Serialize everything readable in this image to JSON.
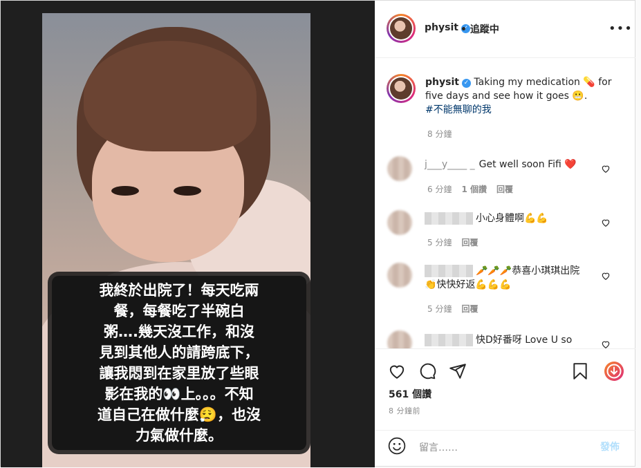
{
  "story": {
    "lines": [
      "我終於出院了！每天吃兩",
      "餐，每餐吃了半碗白",
      "粥….幾天沒工作，和沒",
      "見到其他人的請跨底下，",
      "讓我悶到在家里放了些眼",
      "影在我的👀上。。。不知",
      "道自己在做什麼😮‍💨，也沒",
      "力氣做什麼。"
    ]
  },
  "header": {
    "username": "physit",
    "verified_mark": "✓",
    "follow_status": "• 追蹤中",
    "more_icon": "•••"
  },
  "caption": {
    "username": "physit",
    "text": " Taking my medication 💊 for five days and see how it goes 😬.",
    "hashtag": "#不能無聊的我",
    "time": "8 分鐘"
  },
  "comments": [
    {
      "name_partial": "j___y____ _",
      "text": "Get well soon Fifi ❤️",
      "time": "6 分鐘",
      "likes": "1 個讚",
      "reply": "回覆"
    },
    {
      "name_partial": "",
      "text": "小心身體啊💪💪",
      "time": "5 分鐘",
      "likes": "",
      "reply": "回覆"
    },
    {
      "name_partial": "",
      "text": "🥕🥕🥕恭喜小琪琪出院",
      "text2": "👏快快好返💪💪💪",
      "time": "5 分鐘",
      "likes": "",
      "reply": "回覆"
    },
    {
      "name_partial": "",
      "text": "快D好番呀 Love U so",
      "time": "",
      "likes": "",
      "reply": ""
    }
  ],
  "actions": {
    "likes": "561 個讚",
    "time": "8 分鐘前"
  },
  "add_comment": {
    "placeholder": "留言……",
    "post": "發佈"
  },
  "colors": {
    "link": "#00376b",
    "verified": "#3897f0",
    "post_disabled": "#b2dffc"
  }
}
